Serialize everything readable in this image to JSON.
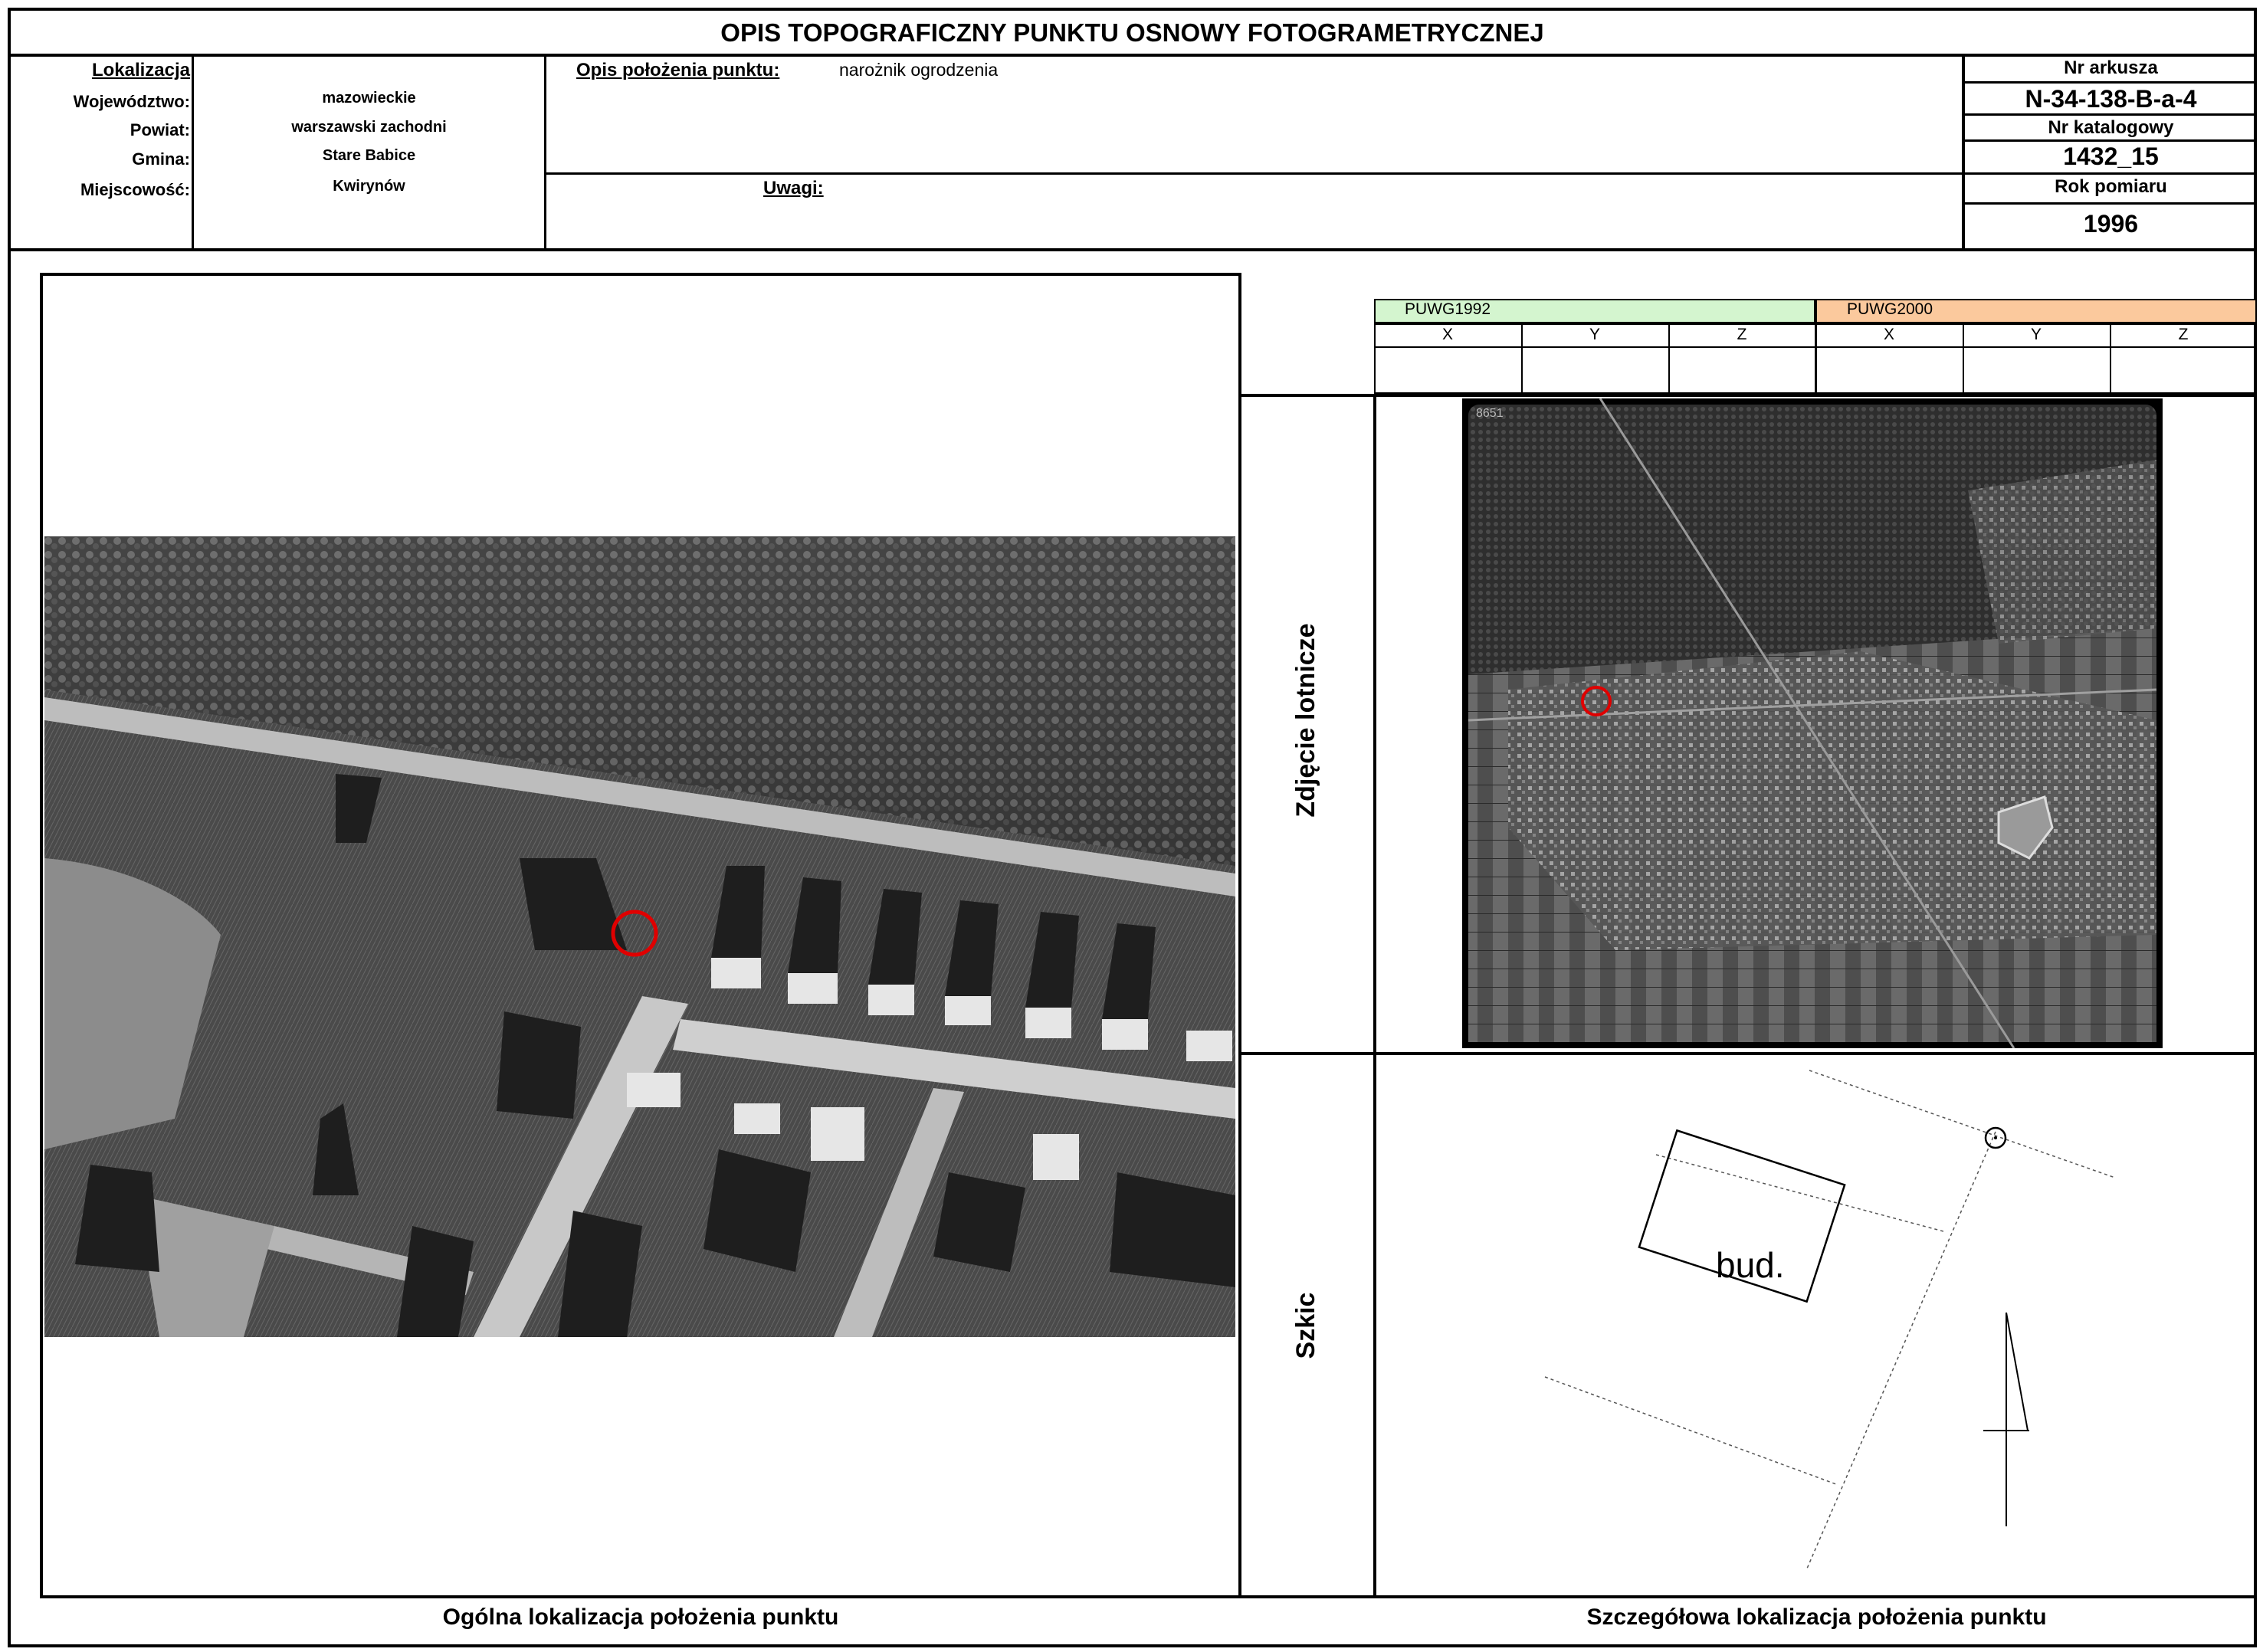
{
  "title": "OPIS TOPOGRAFICZNY PUNKTU OSNOWY FOTOGRAMETRYCZNEJ",
  "location": {
    "header": "Lokalizacja",
    "rows": [
      {
        "label": "Województwo:",
        "value": "mazowieckie"
      },
      {
        "label": "Powiat:",
        "value": "warszawski zachodni"
      },
      {
        "label": "Gmina:",
        "value": "Stare Babice"
      },
      {
        "label": "Miejscowość:",
        "value": "Kwirynów"
      }
    ]
  },
  "description": {
    "label": "Opis położenia punktu:",
    "value": "narożnik ogrodzenia",
    "remarks_label": "Uwagi:"
  },
  "sheet": {
    "sheet_label": "Nr arkusza",
    "sheet_value": "N-34-138-B-a-4",
    "catalog_label": "Nr katalogowy",
    "catalog_value": "1432_15",
    "year_label": "Rok pomiaru",
    "year_value": "1996"
  },
  "coords": {
    "puwg1992": "PUWG1992",
    "puwg2000": "PUWG2000",
    "cols": [
      "X",
      "Y",
      "Z",
      "X",
      "Y",
      "Z"
    ],
    "color1992": "#d4f5cf",
    "color2000": "#fbc99d"
  },
  "aerial_label": "Zdjęcie lotnicze",
  "aerial_frame_no": "8651",
  "sketch_label": "Szkic",
  "sketch_building": "bud.",
  "footer_left": "Ogólna lokalizacja położenia punktu",
  "footer_right": "Szczegółowa lokalizacja położenia punktu",
  "marker_color": "#e00000"
}
